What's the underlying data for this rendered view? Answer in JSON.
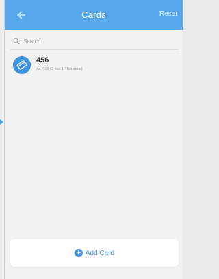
{
  "header": {
    "title": "Cards",
    "reset_label": "Reset"
  },
  "search": {
    "placeholder": "Search"
  },
  "cards": [
    {
      "name": "456",
      "subtitle": "As 4.08 (3 first 1 Thousand)"
    }
  ],
  "footer": {
    "add_label": "Add Card"
  },
  "colors": {
    "accent": "#57a7ec",
    "button_blue": "#3f93dc"
  },
  "icons": [
    "back-arrow-icon",
    "search-icon",
    "card-icon",
    "plus-icon"
  ]
}
